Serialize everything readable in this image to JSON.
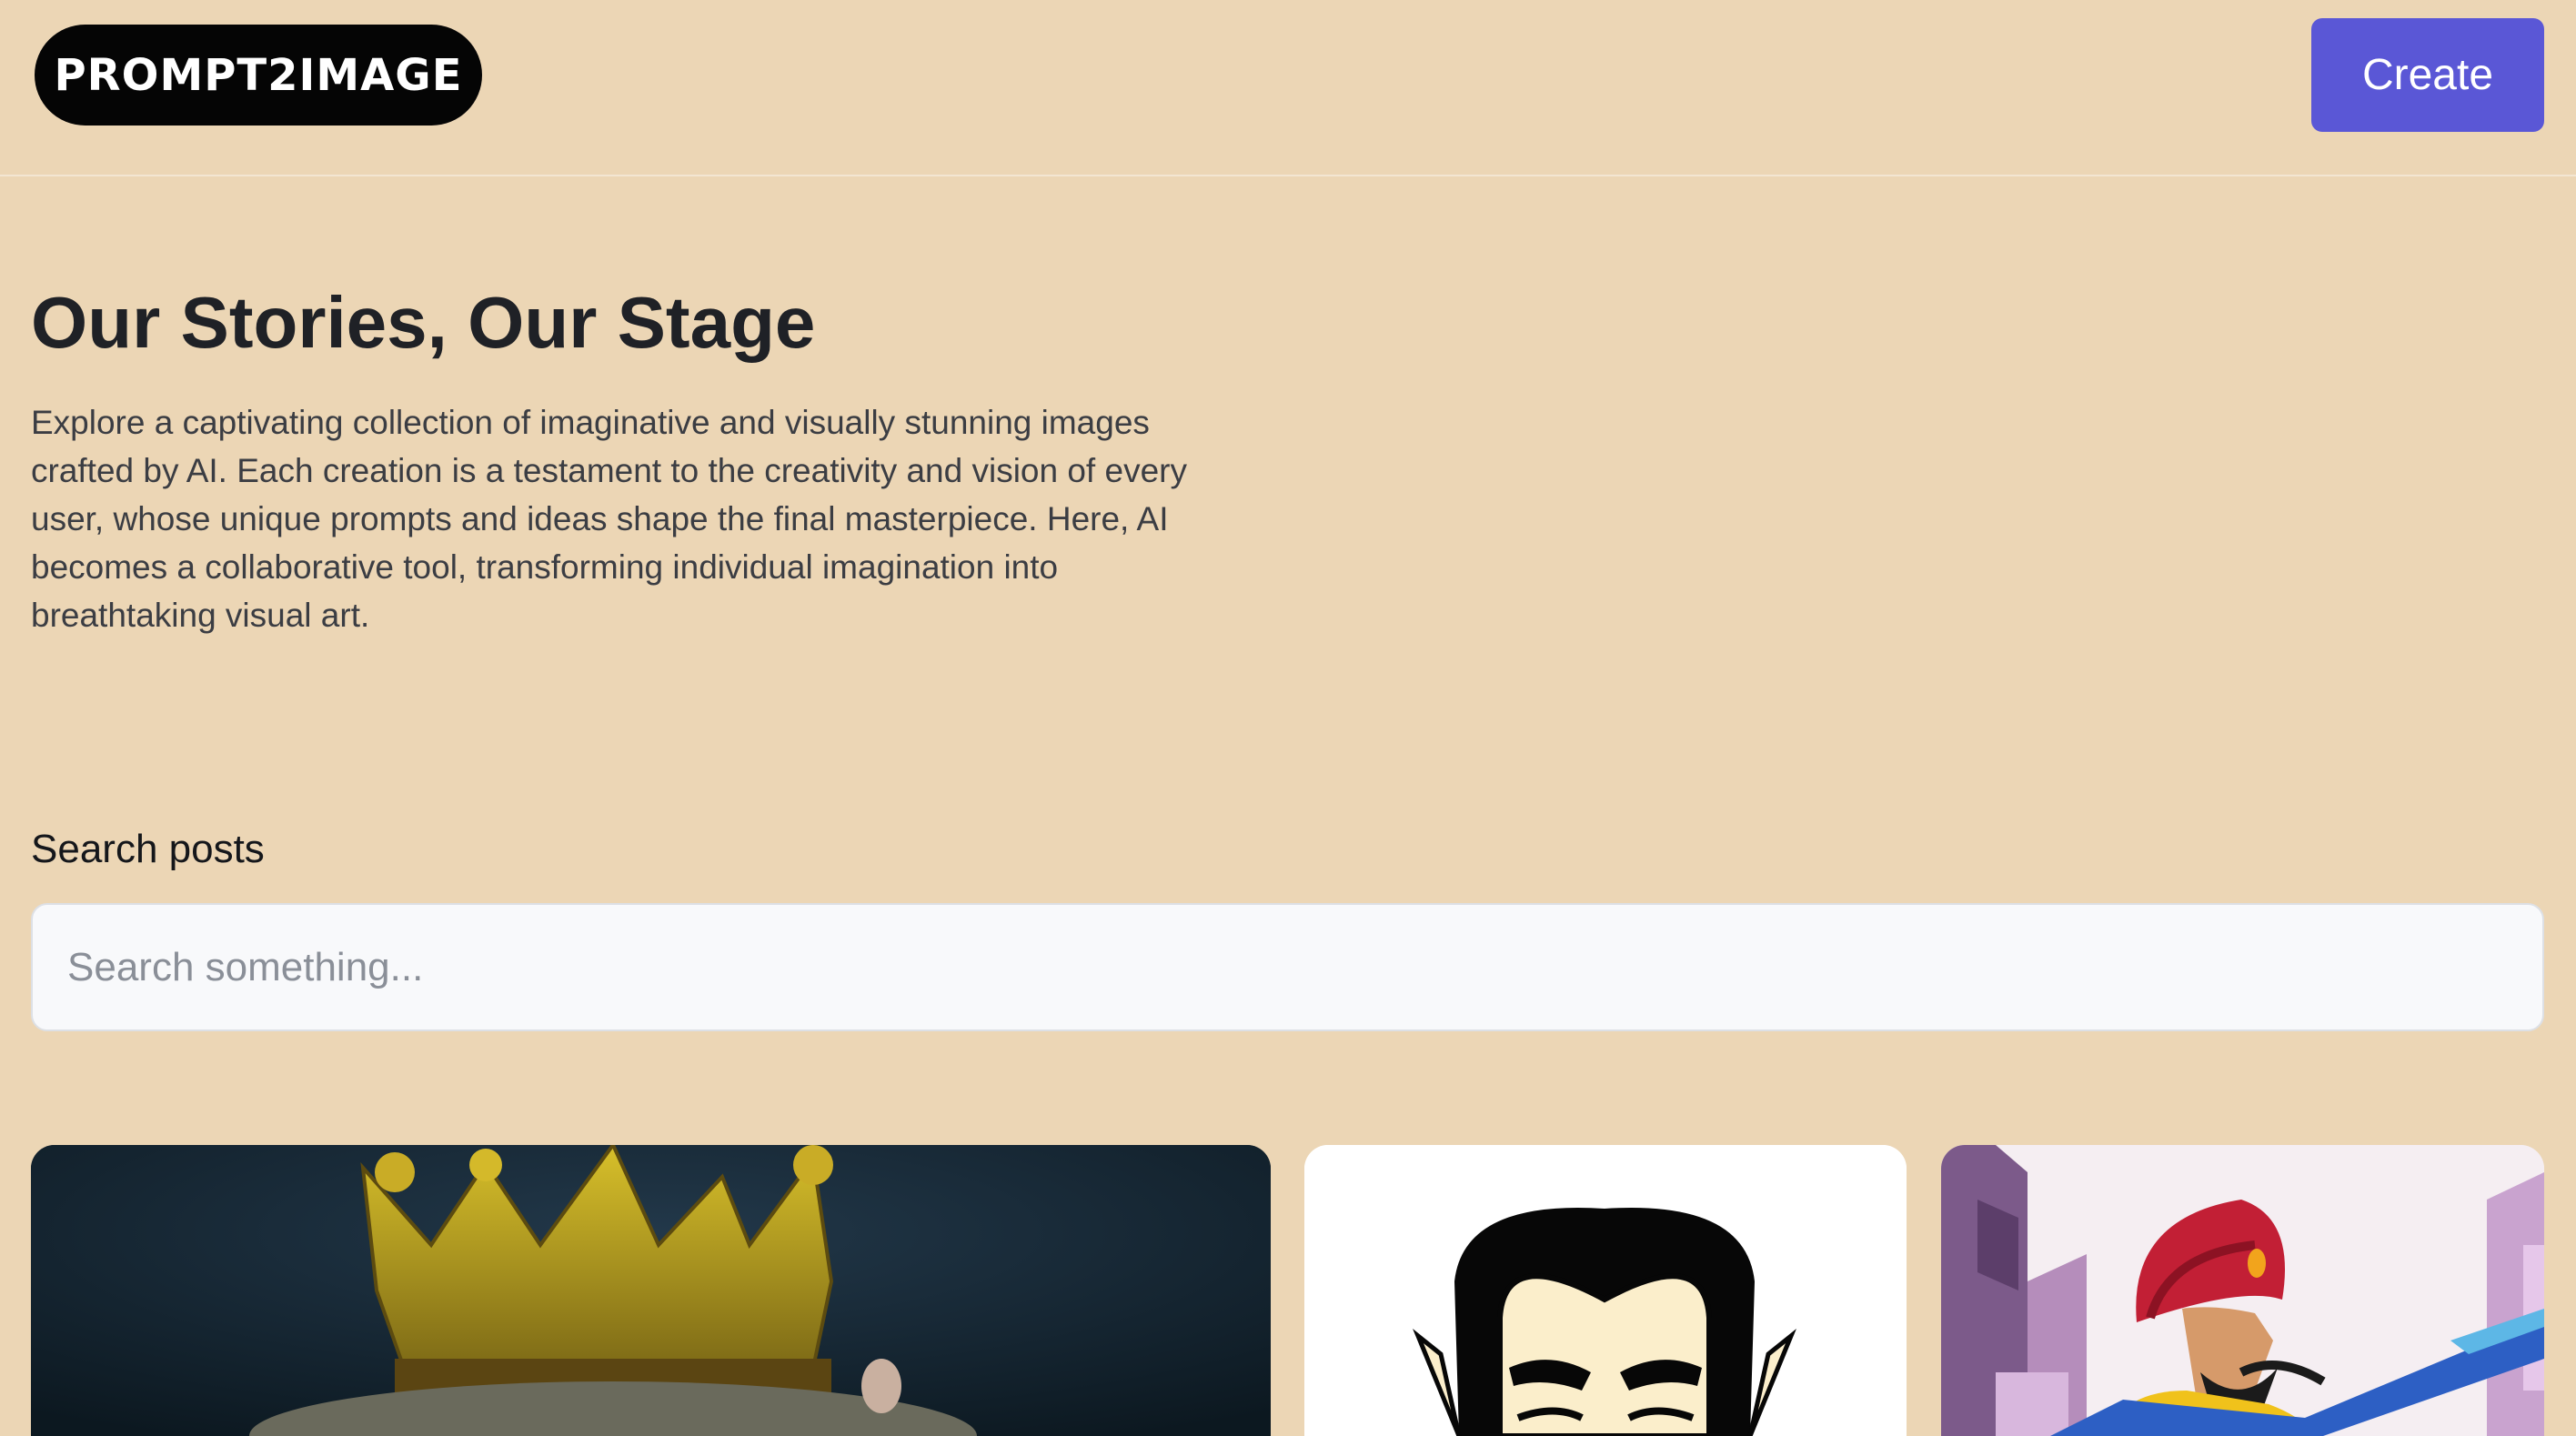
{
  "header": {
    "logo_text": "PROMPT2IMAGE",
    "create_label": "Create",
    "accent_color": "#5a57d6"
  },
  "hero": {
    "title": "Our Stories, Our Stage",
    "description": "Explore a captivating collection of imaginative and visually stunning images crafted by AI. Each creation is a testament to the creativity and vision of every user, whose unique prompts and ideas shape the final masterpiece. Here, AI becomes a collaborative tool, transforming individual imagination into breathtaking visual art."
  },
  "search": {
    "label": "Search posts",
    "placeholder": "Search something...",
    "value": ""
  },
  "gallery": {
    "cards": [
      {
        "subject": "crowned-figure-oil-painting"
      },
      {
        "subject": "cartoon-vampire-face"
      },
      {
        "subject": "turbaned-man-cartoon-in-pink-city"
      }
    ]
  },
  "colors": {
    "background": "#ecd6b5",
    "logo_bg": "#050505"
  }
}
